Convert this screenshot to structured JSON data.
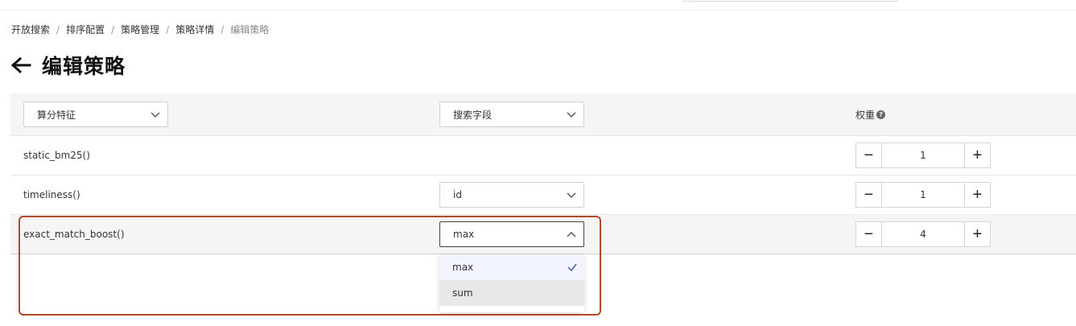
{
  "breadcrumb": {
    "items": [
      "开放搜索",
      "排序配置",
      "策略管理",
      "策略详情"
    ],
    "current": "编辑策略",
    "separator": "/"
  },
  "page": {
    "title": "编辑策略"
  },
  "table": {
    "header": {
      "feature_select": "算分特征",
      "field_select": "搜索字段",
      "weight_label": "权重",
      "help_glyph": "?"
    },
    "rows": [
      {
        "feature": "static_bm25()",
        "field": "",
        "weight": "1"
      },
      {
        "feature": "timeliness()",
        "field": "id",
        "weight": "1"
      },
      {
        "feature": "exact_match_boost()",
        "field": "max",
        "weight": "4"
      }
    ],
    "stepper": {
      "minus": "−",
      "plus": "+"
    }
  },
  "dropdown": {
    "options": [
      {
        "label": "max",
        "selected": true
      },
      {
        "label": "sum",
        "selected": false
      }
    ]
  },
  "colors": {
    "highlight_border": "#b24a28",
    "row_bg": "#f5f5f5",
    "check": "#4a5ea8"
  }
}
